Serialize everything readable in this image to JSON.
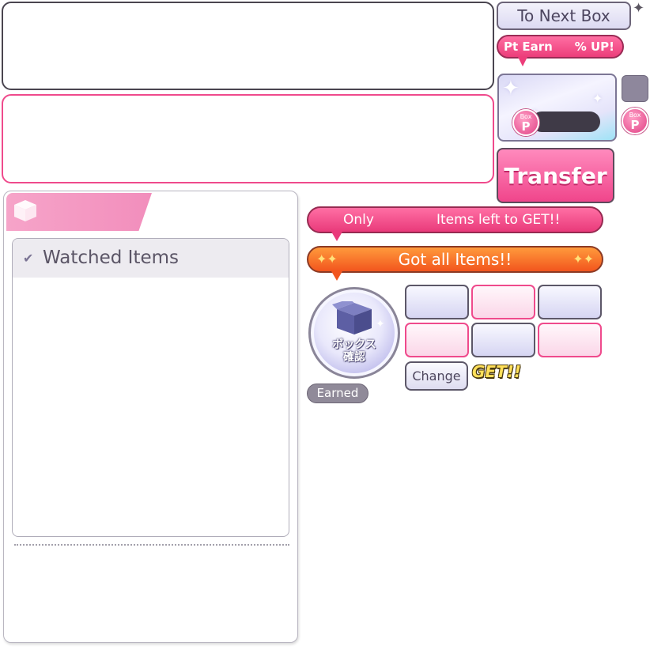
{
  "top": {
    "next_box_label": "To Next Box",
    "pt_earn_label": "Pt Earn",
    "pt_earn_value": "% UP!",
    "box_coin_small": "Box",
    "box_coin_big": "P",
    "transfer_label": "Transfer"
  },
  "list": {
    "header_label": "Watched Items"
  },
  "banners": {
    "only_label": "Only",
    "items_left_label": "Items left to GET!!",
    "got_all_label": "Got all Items!!"
  },
  "box_confirm": {
    "line1": "ボックス",
    "line2": "確認"
  },
  "earned_label": "Earned",
  "change_label": "Change",
  "get_label": "GET!!",
  "colors": {
    "accent_pink": "#ef4a8c",
    "orange": "#f2551e",
    "frame_dark": "#4a4550",
    "lavender": "#dcdaf2"
  },
  "icons": [
    "box-icon",
    "check-icon",
    "sparkle-icon",
    "box-point-coin-icon"
  ]
}
